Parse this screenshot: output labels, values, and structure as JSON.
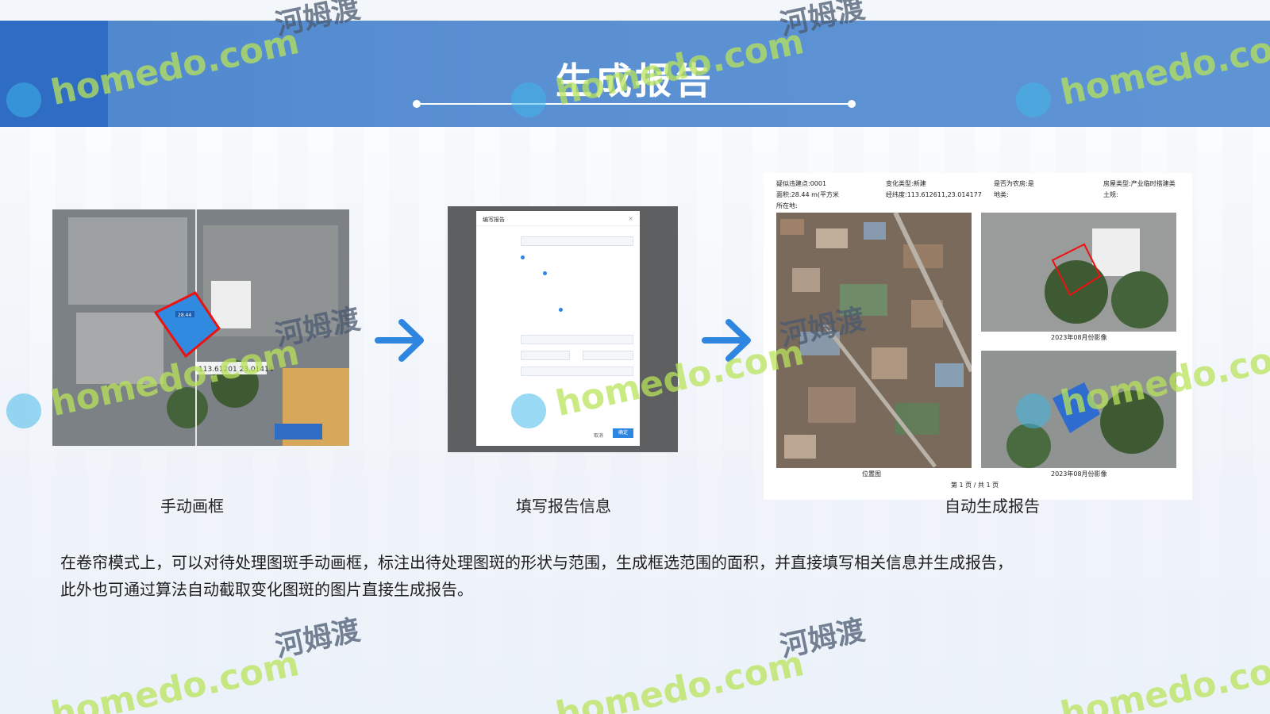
{
  "header": {
    "title": "生成报告",
    "accent_color": "#4f86cd"
  },
  "steps": [
    {
      "caption": "手动画框",
      "icon": "rooftop-aerial-image"
    },
    {
      "caption": "填写报告信息",
      "icon": "report-form-dialog-image"
    },
    {
      "caption": "自动生成报告",
      "icon": "generated-report-image"
    }
  ],
  "panel1": {
    "area_label": "28.44",
    "coords_label": "113.61201  23.01414"
  },
  "form": {
    "title": "编写报告",
    "cancel": "取消",
    "confirm": "确定"
  },
  "report": {
    "point_id": "疑似违建点:0001",
    "change_type": "变化类型:新建",
    "is_farmhouse": "是否为农房:是",
    "house_type": "房屋类型:产业临时搭建类",
    "area": "面积:28.44 m(平方米",
    "lnglat": "经纬度:113.612611,23.014177",
    "land_type": "地类:",
    "soil": "土规:",
    "location": "所在地:",
    "caption_img1": "2023年08月份影像",
    "caption_img2": "2023年08月份影像",
    "caption_loc": "位置图",
    "page": "第 1 页 / 共 1 页"
  },
  "description": {
    "line1": "在卷帘模式上，可以对待处理图斑手动画框，标注出待处理图斑的形状与范围，生成框选范围的面积，并直接填写相关信息并生成报告，",
    "line2": "此外也可通过算法自动截取变化图斑的图片直接生成报告。"
  },
  "watermark": {
    "latin": "homedo.com",
    "cn": "河姆渡"
  }
}
